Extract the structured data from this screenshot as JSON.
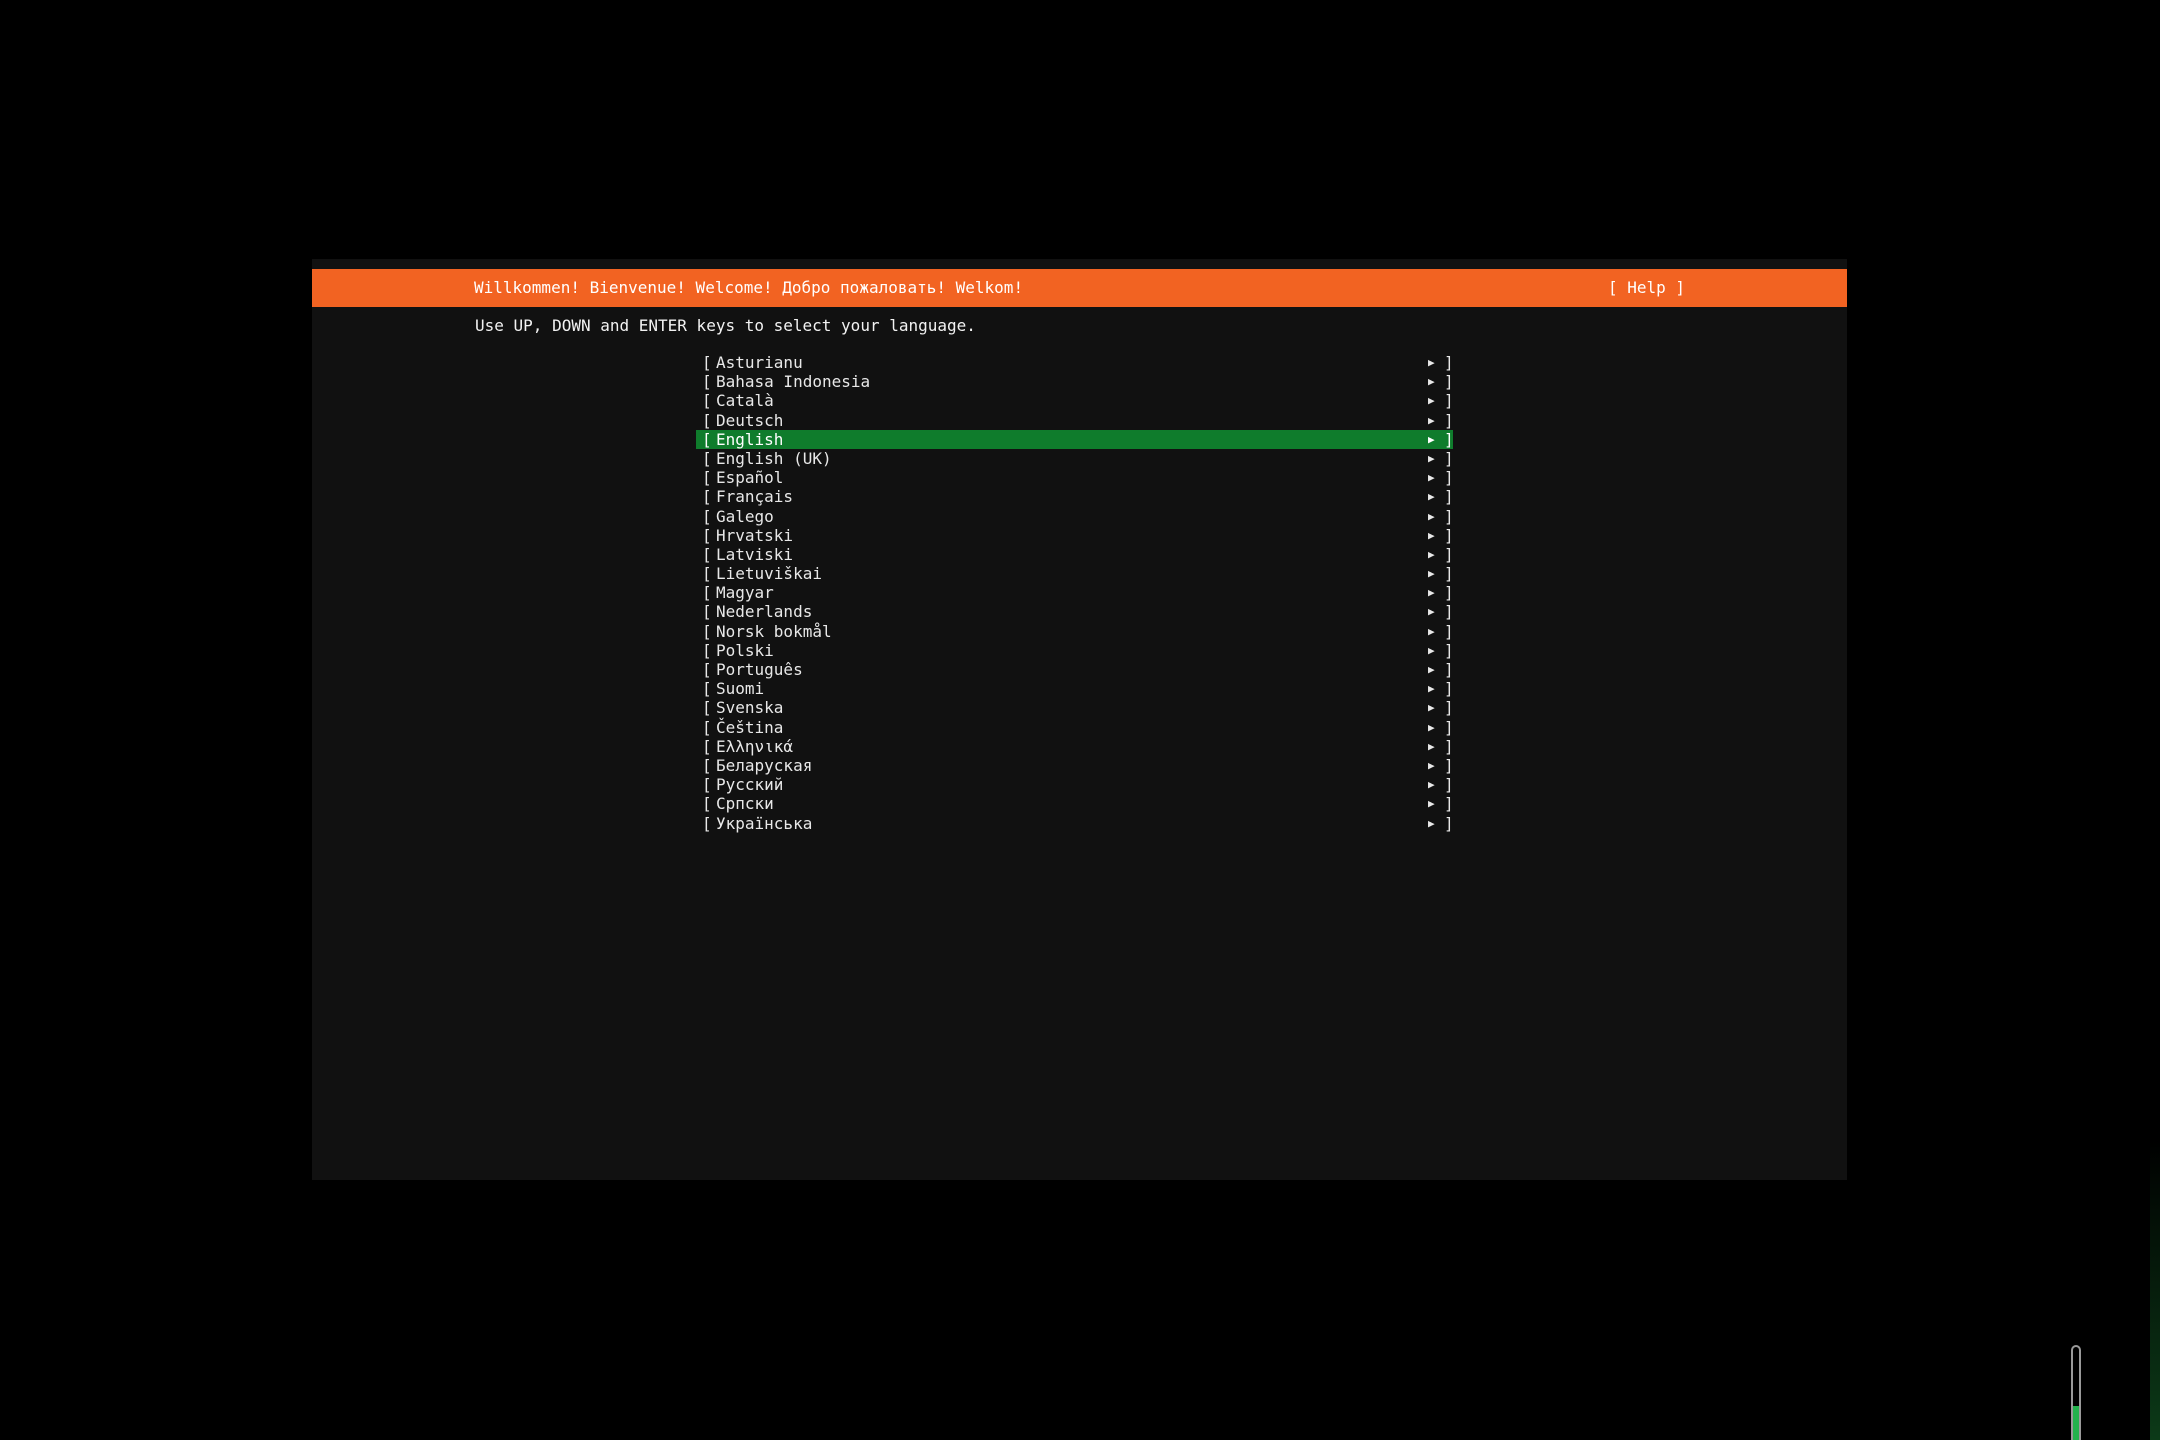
{
  "header": {
    "title": "Willkommen! Bienvenue! Welcome! Добро пожаловать! Welkom!",
    "help_label": "[ Help ]"
  },
  "instruction": "Use UP, DOWN and ENTER keys to select your language.",
  "languages": [
    {
      "label": "Asturianu",
      "selected": false
    },
    {
      "label": "Bahasa Indonesia",
      "selected": false
    },
    {
      "label": "Català",
      "selected": false
    },
    {
      "label": "Deutsch",
      "selected": false
    },
    {
      "label": "English",
      "selected": true
    },
    {
      "label": "English (UK)",
      "selected": false
    },
    {
      "label": "Español",
      "selected": false
    },
    {
      "label": "Français",
      "selected": false
    },
    {
      "label": "Galego",
      "selected": false
    },
    {
      "label": "Hrvatski",
      "selected": false
    },
    {
      "label": "Latviski",
      "selected": false
    },
    {
      "label": "Lietuviškai",
      "selected": false
    },
    {
      "label": "Magyar",
      "selected": false
    },
    {
      "label": "Nederlands",
      "selected": false
    },
    {
      "label": "Norsk bokmål",
      "selected": false
    },
    {
      "label": "Polski",
      "selected": false
    },
    {
      "label": "Português",
      "selected": false
    },
    {
      "label": "Suomi",
      "selected": false
    },
    {
      "label": "Svenska",
      "selected": false
    },
    {
      "label": "Čeština",
      "selected": false
    },
    {
      "label": "Ελληνικά",
      "selected": false
    },
    {
      "label": "Беларуская",
      "selected": false
    },
    {
      "label": "Русский",
      "selected": false
    },
    {
      "label": "Српски",
      "selected": false
    },
    {
      "label": "Українська",
      "selected": false
    }
  ],
  "list_glyphs": {
    "left_bracket": "[",
    "right_bracket": "]",
    "arrow": "▶"
  },
  "colors": {
    "header_bg": "#f26322",
    "selected_bg": "#0f7c2c",
    "screen_bg": "#111111",
    "text": "#e8e8e8",
    "indicator_fill": "#22b24c"
  },
  "indicator": {
    "icon": "level-indicator-icon",
    "level": 0.37
  }
}
